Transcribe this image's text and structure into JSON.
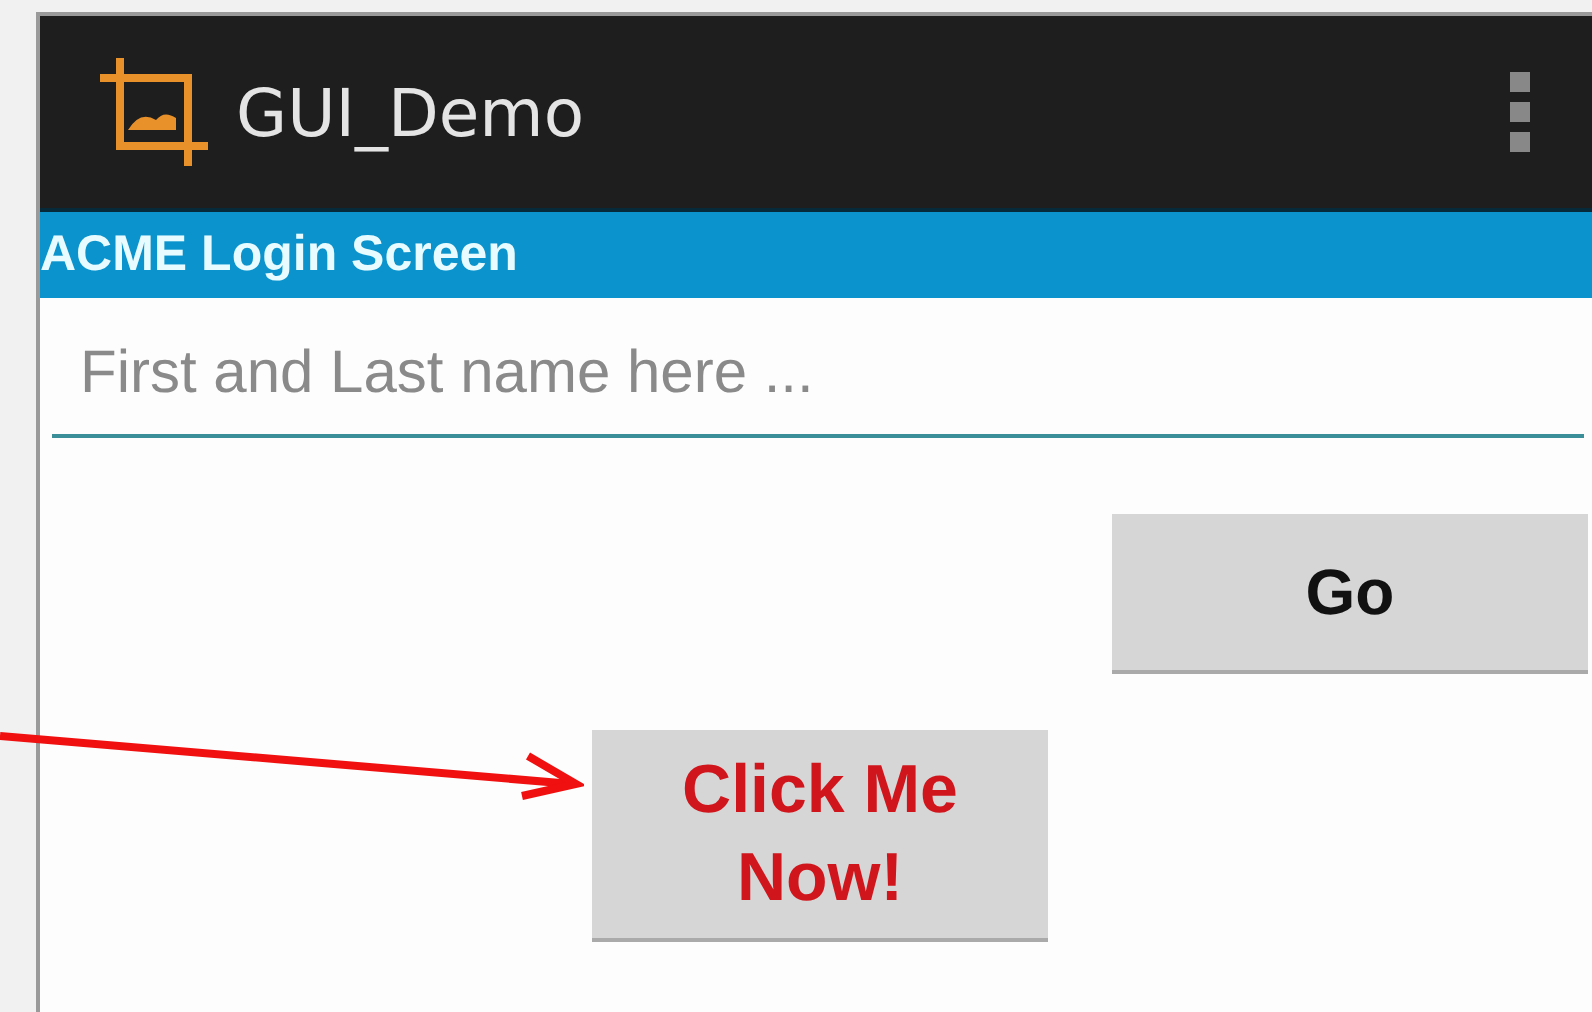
{
  "app_bar": {
    "title": "GUI_Demo"
  },
  "header": {
    "title": "ACME Login Screen"
  },
  "name_field": {
    "placeholder": "First and Last name here ..."
  },
  "go_button": {
    "label": "Go"
  },
  "click_button": {
    "label": "Click Me Now!"
  }
}
